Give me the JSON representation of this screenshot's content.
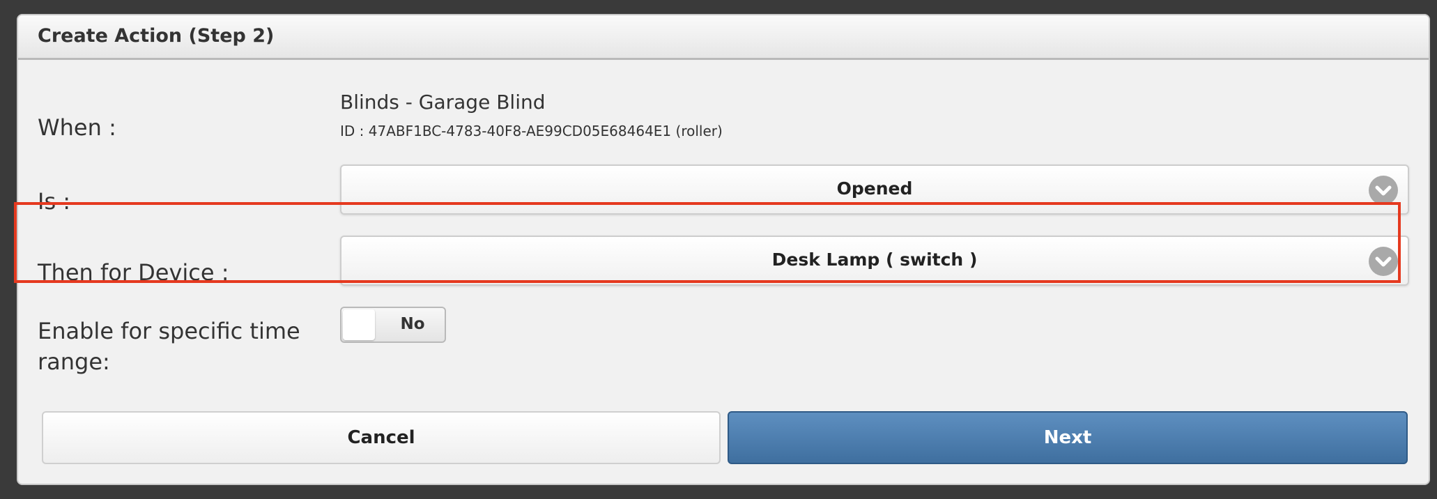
{
  "dialog": {
    "title": "Create Action (Step 2)"
  },
  "form": {
    "when_label": "When :",
    "when_device": "Blinds - Garage Blind",
    "when_id": "ID : 47ABF1BC-4783-40F8-AE99CD05E68464E1 (roller)",
    "is_label": "Is :",
    "is_value": "Opened",
    "device_label": "Then for Device :",
    "device_value": "Desk Lamp ( switch )",
    "time_range_label_line1": "Enable for specific time",
    "time_range_label_line2": "range:",
    "time_range_toggle": "No"
  },
  "buttons": {
    "cancel": "Cancel",
    "next": "Next"
  },
  "colors": {
    "highlight": "#e5391f",
    "primary_button": "#4a7aab"
  },
  "icons": {
    "select_arrow": "chevron-down-icon"
  }
}
